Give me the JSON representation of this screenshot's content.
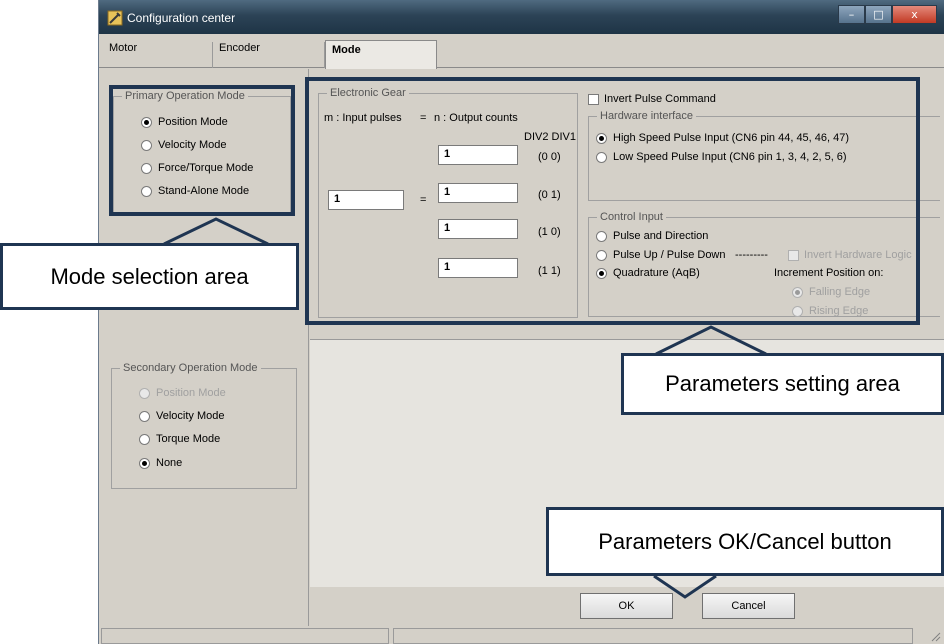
{
  "window": {
    "title": "Configuration center",
    "buttons": {
      "minimize": "–",
      "maximize": "□",
      "close": "x"
    }
  },
  "tabs": [
    {
      "label": "Motor"
    },
    {
      "label": "Encoder"
    },
    {
      "label": "Mode"
    }
  ],
  "primary_mode": {
    "title": "Primary Operation Mode",
    "options": [
      "Position Mode",
      "Velocity Mode",
      "Force/Torque Mode",
      "Stand-Alone Mode"
    ],
    "selected": "Position Mode"
  },
  "secondary_mode": {
    "title": "Secondary Operation Mode",
    "options": [
      "Position Mode",
      "Velocity Mode",
      "Torque Mode",
      "None"
    ],
    "selected": "None",
    "disabled": [
      "Position Mode"
    ]
  },
  "electronic_gear": {
    "title": "Electronic Gear",
    "header_left": "m : Input pulses",
    "header_eq": "=",
    "header_right": "n : Output counts",
    "div_header": "DIV2 DIV1",
    "input_value": "1",
    "equals": "=",
    "rows": [
      {
        "value": "1",
        "div": "(0 0)"
      },
      {
        "value": "1",
        "div": "(0 1)"
      },
      {
        "value": "1",
        "div": "(1 0)"
      },
      {
        "value": "1",
        "div": "(1 1)"
      }
    ]
  },
  "invert_pulse": {
    "label": "Invert Pulse Command",
    "checked": false
  },
  "hardware_interface": {
    "title": "Hardware interface",
    "options": [
      "High Speed Pulse Input (CN6 pin 44, 45, 46, 47)",
      "Low Speed Pulse Input (CN6 pin 1, 3, 4, 2, 5, 6)"
    ],
    "selected": "High Speed Pulse Input (CN6 pin 44, 45, 46, 47)"
  },
  "control_input": {
    "title": "Control Input",
    "options": [
      "Pulse and Direction",
      "Pulse Up / Pulse Down",
      "Quadrature (AqB)"
    ],
    "selected": "Quadrature (AqB)",
    "dashes": "---------",
    "invert_hw_logic": "Invert Hardware Logic",
    "increment_label": "Increment Position on:",
    "edges": [
      "Falling Edge",
      "Rising Edge"
    ],
    "edge_selected": "Falling Edge"
  },
  "buttons": {
    "ok": "OK",
    "cancel": "Cancel"
  },
  "callouts": {
    "mode_selection": "Mode selection area",
    "parameters_setting": "Parameters setting area",
    "ok_cancel": "Parameters OK/Cancel button"
  },
  "colors": {
    "callout_border": "#1f3552",
    "titlebar": "#2c4356",
    "window_bg": "#d4d0c8"
  }
}
